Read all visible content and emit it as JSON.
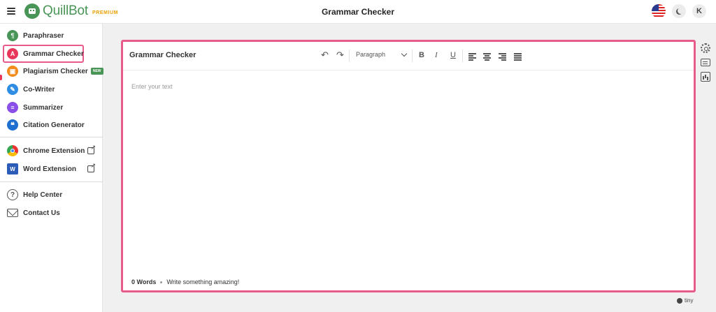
{
  "header": {
    "app_name": "QuillBot",
    "plan_badge": "PREMIUM",
    "page_title": "Grammar Checker",
    "avatar_initial": "K",
    "flag_icon": "us-flag-icon",
    "theme_icon": "moon-icon"
  },
  "sidebar": {
    "items": [
      {
        "label": "Paraphraser",
        "icon": "paraphraser-icon",
        "color": "#499557"
      },
      {
        "label": "Grammar Checker",
        "icon": "grammar-checker-icon",
        "color": "#e8375b",
        "active": true
      },
      {
        "label": "Plagiarism Checker",
        "icon": "plagiarism-icon",
        "color": "#f28a1c",
        "badge": "NEW"
      },
      {
        "label": "Co-Writer",
        "icon": "co-writer-icon",
        "color": "#2f8de4"
      },
      {
        "label": "Summarizer",
        "icon": "summarizer-icon",
        "color": "#8a4fe8"
      },
      {
        "label": "Citation Generator",
        "icon": "citation-icon",
        "color": "#1f6fd0"
      }
    ],
    "extensions": [
      {
        "label": "Chrome Extension",
        "icon": "chrome-icon"
      },
      {
        "label": "Word Extension",
        "icon": "word-icon"
      }
    ],
    "support": [
      {
        "label": "Help Center",
        "icon": "help-icon"
      },
      {
        "label": "Contact Us",
        "icon": "mail-icon"
      }
    ]
  },
  "editor": {
    "title": "Grammar Checker",
    "block_format": "Paragraph",
    "placeholder": "Enter your text",
    "word_count": "0 Words",
    "hint": "Write something amazing!",
    "powered_by": "tiny",
    "toolbar": {
      "bold": "B",
      "italic": "I",
      "underline": "U"
    }
  },
  "colors": {
    "brand": "#499557",
    "highlight": "#e85a8b",
    "premium": "#e8a000"
  }
}
